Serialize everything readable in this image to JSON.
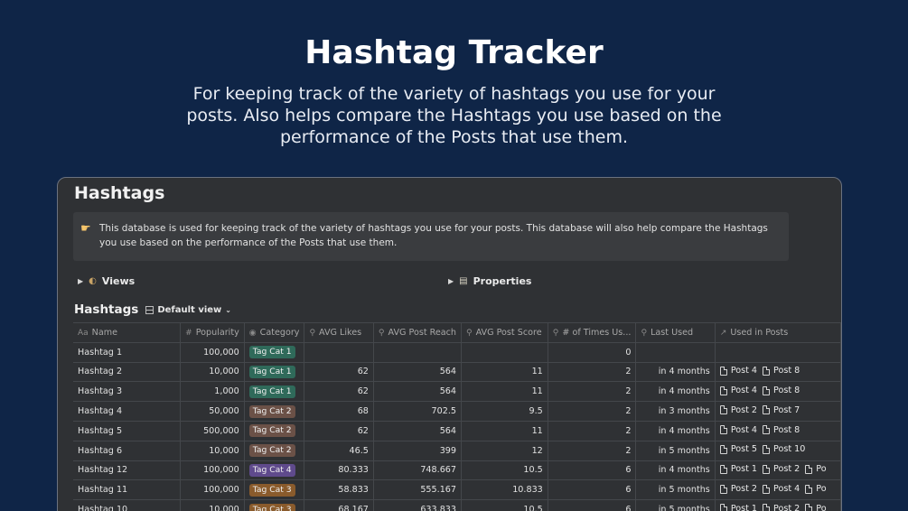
{
  "hero": {
    "title": "Hashtag Tracker",
    "subtitle": "For keeping track of the variety of hashtags you use for your posts. Also helps compare the Hashtags you use based on the performance of the Posts that use them."
  },
  "page": {
    "title": "Hashtags",
    "callout_icon": "pointing-hand-icon",
    "callout_text": "This database is used for keeping track of the variety of hashtags you use for your posts. This database will also help compare the Hashtags you use based on the performance of the Posts that use them."
  },
  "toggles": {
    "views": "Views",
    "properties": "Properties"
  },
  "database": {
    "title": "Hashtags",
    "view": "Default view"
  },
  "columns": {
    "name": "Name",
    "popularity": "Popularity",
    "category": "Category",
    "avg_likes": "AVG Likes",
    "avg_reach": "AVG Post Reach",
    "avg_score": "AVG Post Score",
    "times_used": "# of Times Us...",
    "last_used": "Last Used",
    "used_in": "Used in Posts"
  },
  "tag_colors": {
    "Tag Cat 1": "#2f6a5a",
    "Tag Cat 2": "#6b5147",
    "Tag Cat 3": "#8a5b2c",
    "Tag Cat 4": "#5f4a8c"
  },
  "rows": [
    {
      "name": "Hashtag 1",
      "popularity": "100,000",
      "category": "Tag Cat 1",
      "likes": "",
      "reach": "",
      "score": "",
      "times": "0",
      "last": "",
      "posts": []
    },
    {
      "name": "Hashtag 2",
      "popularity": "10,000",
      "category": "Tag Cat 1",
      "likes": "62",
      "reach": "564",
      "score": "11",
      "times": "2",
      "last": "in 4 months",
      "posts": [
        "Post 4",
        "Post 8"
      ]
    },
    {
      "name": "Hashtag 3",
      "popularity": "1,000",
      "category": "Tag Cat 1",
      "likes": "62",
      "reach": "564",
      "score": "11",
      "times": "2",
      "last": "in 4 months",
      "posts": [
        "Post 4",
        "Post 8"
      ]
    },
    {
      "name": "Hashtag 4",
      "popularity": "50,000",
      "category": "Tag Cat 2",
      "likes": "68",
      "reach": "702.5",
      "score": "9.5",
      "times": "2",
      "last": "in 3 months",
      "posts": [
        "Post 2",
        "Post 7"
      ]
    },
    {
      "name": "Hashtag 5",
      "popularity": "500,000",
      "category": "Tag Cat 2",
      "likes": "62",
      "reach": "564",
      "score": "11",
      "times": "2",
      "last": "in 4 months",
      "posts": [
        "Post 4",
        "Post 8"
      ]
    },
    {
      "name": "Hashtag 6",
      "popularity": "10,000",
      "category": "Tag Cat 2",
      "likes": "46.5",
      "reach": "399",
      "score": "12",
      "times": "2",
      "last": "in 5 months",
      "posts": [
        "Post 5",
        "Post 10"
      ]
    },
    {
      "name": "Hashtag 12",
      "popularity": "100,000",
      "category": "Tag Cat 4",
      "likes": "80.333",
      "reach": "748.667",
      "score": "10.5",
      "times": "6",
      "last": "in 4 months",
      "posts": [
        "Post 1",
        "Post 2",
        "Po"
      ]
    },
    {
      "name": "Hashtag 11",
      "popularity": "100,000",
      "category": "Tag Cat 3",
      "likes": "58.833",
      "reach": "555.167",
      "score": "10.833",
      "times": "6",
      "last": "in 5 months",
      "posts": [
        "Post 2",
        "Post 4",
        "Po"
      ]
    },
    {
      "name": "Hashtag 10",
      "popularity": "10,000",
      "category": "Tag Cat 3",
      "likes": "68.167",
      "reach": "633.833",
      "score": "10.5",
      "times": "6",
      "last": "in 5 months",
      "posts": [
        "Post 1",
        "Post 2",
        "Po"
      ]
    }
  ]
}
